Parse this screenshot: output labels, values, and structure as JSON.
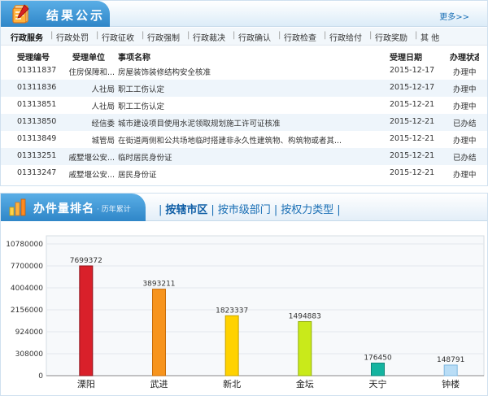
{
  "results": {
    "title": "结果公示",
    "more": "更多>>",
    "categories": [
      "行政服务",
      "行政处罚",
      "行政征收",
      "行政强制",
      "行政裁决",
      "行政确认",
      "行政检查",
      "行政给付",
      "行政奖励",
      "其 他"
    ],
    "columns": [
      "受理编号",
      "受理单位",
      "事项名称",
      "受理日期",
      "办理状态"
    ],
    "rows": [
      {
        "id": "01311837",
        "unit": "住房保障和...",
        "name": "房屋装饰装修结构安全核准",
        "date": "2015-12-17",
        "status": "办理中"
      },
      {
        "id": "01311836",
        "unit": "人社局",
        "name": "职工工伤认定",
        "date": "2015-12-17",
        "status": "办理中"
      },
      {
        "id": "01313851",
        "unit": "人社局",
        "name": "职工工伤认定",
        "date": "2015-12-21",
        "status": "办理中"
      },
      {
        "id": "01313850",
        "unit": "经信委",
        "name": "城市建设项目使用水泥领取规划施工许可证核准",
        "date": "2015-12-21",
        "status": "已办结"
      },
      {
        "id": "01313849",
        "unit": "城管局",
        "name": "在街道两侧和公共场地临时搭建非永久性建筑物、构筑物或者其...",
        "date": "2015-12-21",
        "status": "办理中"
      },
      {
        "id": "01313251",
        "unit": "戚墅堰公安...",
        "name": "临时居民身份证",
        "date": "2015-12-21",
        "status": "已办结"
      },
      {
        "id": "01313247",
        "unit": "戚墅堰公安...",
        "name": "居民身份证",
        "date": "2015-12-21",
        "status": "办理中"
      }
    ]
  },
  "ranking": {
    "title": "办件量排名",
    "subtitle": "· 历年累计",
    "tabs": [
      "按辖市区",
      "按市级部门",
      "按权力类型"
    ]
  },
  "chart_data": {
    "type": "bar",
    "categories": [
      "溧阳",
      "武进",
      "新北",
      "金坛",
      "天宁",
      "钟楼"
    ],
    "values": [
      7699372,
      3893211,
      1823337,
      1494883,
      176450,
      148791
    ],
    "y_ticks": [
      "10780000",
      "7700000",
      "4004000",
      "2156000",
      "924000",
      "308000",
      "0"
    ],
    "bar_colors": [
      "#d9202a",
      "#f7941d",
      "#ffd200",
      "#c9ea1a",
      "#15b4a0",
      "#b9ddf6"
    ],
    "bar_edges": [
      "#8f1018",
      "#c86d0a",
      "#c7a300",
      "#93ae08",
      "#0c8577",
      "#7fb8e0"
    ],
    "scale": "non-linear (evenly spaced ticks)"
  }
}
